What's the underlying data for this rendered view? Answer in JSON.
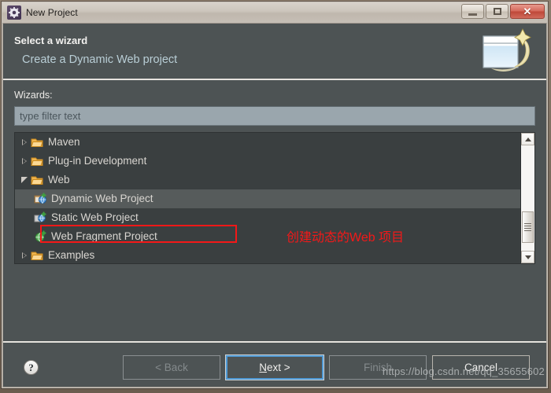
{
  "window": {
    "title": "New Project",
    "icon": "gear-icon",
    "controls": {
      "minimize": "minimize-icon",
      "maximize": "maximize-icon",
      "close": "✕"
    }
  },
  "header": {
    "title": "Select a wizard",
    "subtitle": "Create a Dynamic Web project",
    "icon": "new-wizard-icon"
  },
  "content": {
    "wizards_label": "Wizards:",
    "filter": {
      "value": "",
      "placeholder": "type filter text"
    }
  },
  "tree": {
    "items": [
      {
        "label": "Maven",
        "icon": "folder-icon",
        "level": 1,
        "twisty": "collapsed",
        "selected": false
      },
      {
        "label": "Plug-in Development",
        "icon": "folder-icon",
        "level": 1,
        "twisty": "collapsed",
        "selected": false
      },
      {
        "label": "Web",
        "icon": "folder-icon",
        "level": 1,
        "twisty": "expanded",
        "selected": false
      },
      {
        "label": "Dynamic Web Project",
        "icon": "dynamic-web-project-icon",
        "level": 2,
        "twisty": "none",
        "selected": true
      },
      {
        "label": "Static Web Project",
        "icon": "static-web-project-icon",
        "level": 2,
        "twisty": "none",
        "selected": false
      },
      {
        "label": "Web Fragment Project",
        "icon": "web-fragment-project-icon",
        "level": 2,
        "twisty": "none",
        "selected": false
      },
      {
        "label": "Examples",
        "icon": "folder-icon",
        "level": 1,
        "twisty": "collapsed",
        "selected": false
      }
    ],
    "scrollbar": {
      "up_arrow": "scroll-up-icon",
      "down_arrow": "scroll-down-icon"
    }
  },
  "annotation": {
    "text": "创建动态的Web 项目",
    "color": "#f41818"
  },
  "footer": {
    "help_label": "?",
    "buttons": [
      {
        "label": "< Back",
        "state": "disabled"
      },
      {
        "label": "Next >",
        "state": "focused",
        "mnemonic": "N"
      },
      {
        "label": "Finish",
        "state": "disabled"
      },
      {
        "label": "Cancel",
        "state": "normal"
      }
    ]
  },
  "watermark": {
    "text": "https://blog.csdn.net/qq_35655602"
  },
  "colors": {
    "dialog_bg": "#4d5354",
    "tree_bg": "#3a3f40",
    "selection": "#565b5b",
    "accent_link": "#b9ced6",
    "focus_blue": "#4f9ad6",
    "annotation_red": "#f41818"
  }
}
